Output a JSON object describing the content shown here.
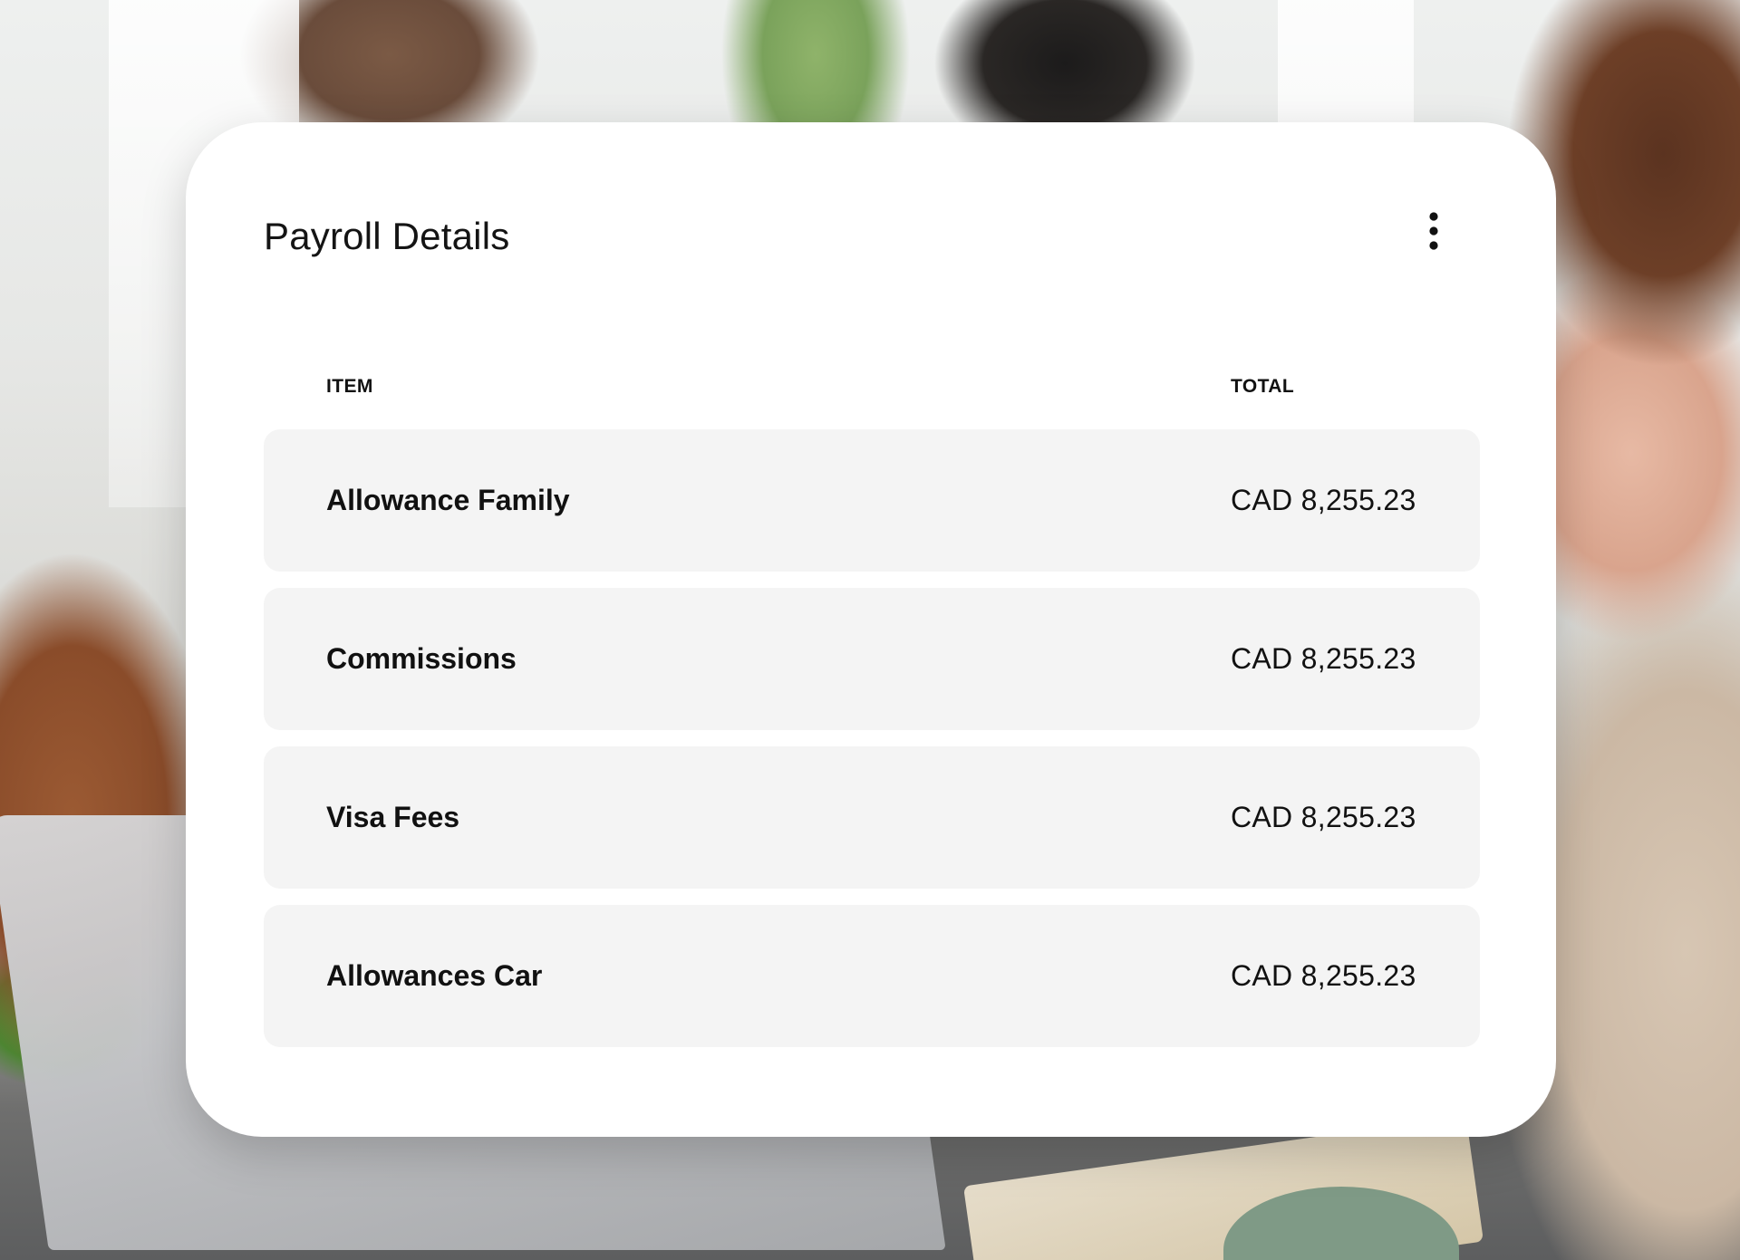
{
  "card": {
    "title": "Payroll Details",
    "menu_icon": "more-vertical-icon"
  },
  "table": {
    "headers": {
      "item": "ITEM",
      "total": "TOTAL"
    },
    "rows": [
      {
        "item": "Allowance Family",
        "total": "CAD 8,255.23"
      },
      {
        "item": "Commissions",
        "total": "CAD 8,255.23"
      },
      {
        "item": "Visa Fees",
        "total": "CAD 8,255.23"
      },
      {
        "item": "Allowances Car",
        "total": "CAD 8,255.23"
      }
    ]
  },
  "colors": {
    "card_background": "#ffffff",
    "row_background": "#f4f4f4",
    "text": "#111111"
  }
}
